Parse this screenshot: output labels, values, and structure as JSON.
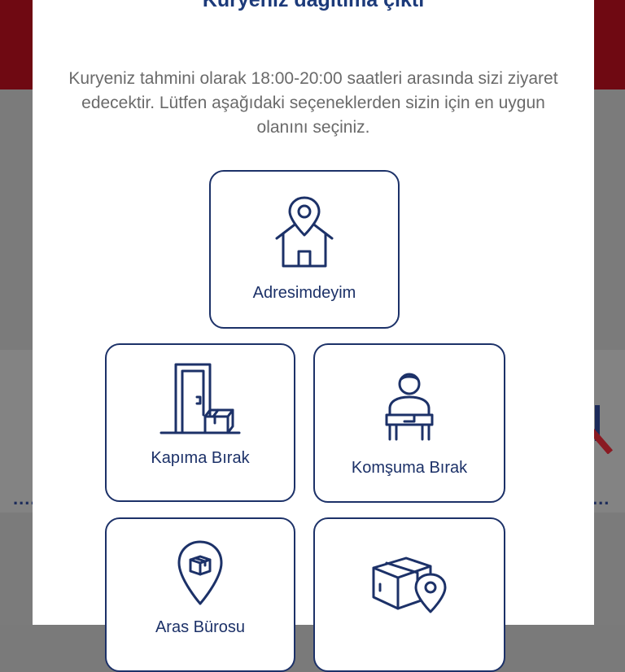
{
  "dialog": {
    "title": "Kuryeniz dağıtıma çıktı",
    "description": "Kuryeniz tahmini olarak 18:00-20:00 saatleri arasında sizi ziyaret edecektir. Lütfen aşağıdaki seçeneklerden sizin için en uygun olanını seçiniz."
  },
  "options": [
    {
      "label": "Adresimdeyim",
      "icon": "house-location-icon"
    },
    {
      "label": "Kapıma Bırak",
      "icon": "door-package-icon"
    },
    {
      "label": "Komşuma Bırak",
      "icon": "neighbor-package-icon"
    },
    {
      "label": "Aras Bürosu",
      "icon": "branch-location-icon"
    },
    {
      "label": "",
      "icon": "package-location-icon"
    }
  ],
  "background": {
    "dots_left": "....",
    "dots_right": "..."
  },
  "colors": {
    "accent": "#1c3168",
    "title": "#1c3a7a",
    "text_muted": "#6a6a6a",
    "brand_red": "#6f0912"
  }
}
